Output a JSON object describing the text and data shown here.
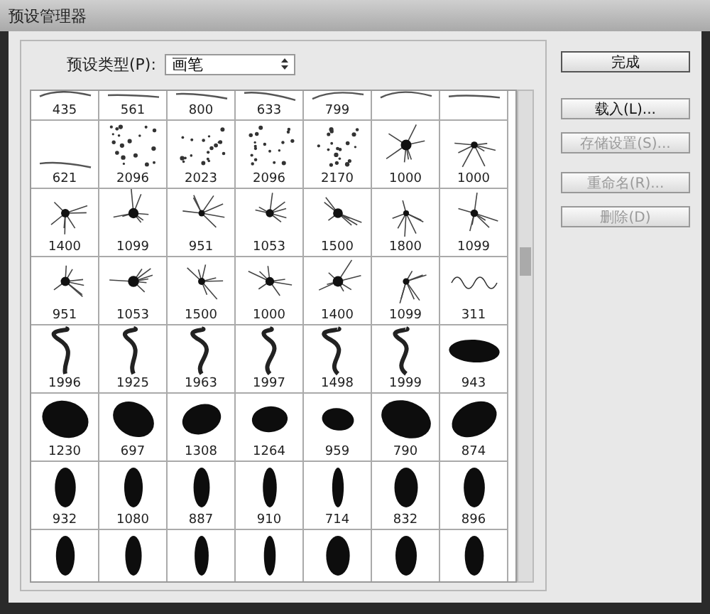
{
  "window": {
    "title": "预设管理器"
  },
  "preset_type": {
    "label": "预设类型(P):",
    "value": "画笔"
  },
  "brush_rows": [
    {
      "cells": [
        {
          "kind": "sparse",
          "label": "435"
        },
        {
          "kind": "sparse",
          "label": "561"
        },
        {
          "kind": "sparse",
          "label": "800"
        },
        {
          "kind": "sparse",
          "label": "633"
        },
        {
          "kind": "sparse",
          "label": "799"
        },
        {
          "kind": "sparse"
        },
        {
          "kind": "sparse"
        }
      ]
    },
    {
      "cells": [
        {
          "kind": "sparse",
          "label": "621"
        },
        {
          "kind": "dots",
          "label": "2096"
        },
        {
          "kind": "dots",
          "label": "2023"
        },
        {
          "kind": "dots",
          "label": "2096"
        },
        {
          "kind": "dots",
          "label": "2170"
        },
        {
          "kind": "splatter",
          "label": "1000"
        },
        {
          "kind": "splatter",
          "label": "1000"
        }
      ]
    },
    {
      "cells": [
        {
          "kind": "splatter",
          "label": "1400"
        },
        {
          "kind": "splatter",
          "label": "1099"
        },
        {
          "kind": "splatter",
          "label": "951"
        },
        {
          "kind": "splatter",
          "label": "1053"
        },
        {
          "kind": "splatter",
          "label": "1500"
        },
        {
          "kind": "splatter",
          "label": "1800"
        },
        {
          "kind": "splatter",
          "label": "1099"
        }
      ]
    },
    {
      "cells": [
        {
          "kind": "splatter",
          "label": "951"
        },
        {
          "kind": "splatter",
          "label": "1053"
        },
        {
          "kind": "splatter",
          "label": "1500"
        },
        {
          "kind": "splatter",
          "label": "1000"
        },
        {
          "kind": "splatter",
          "label": "1400"
        },
        {
          "kind": "splatter",
          "label": "1099"
        },
        {
          "kind": "script",
          "label": "311"
        }
      ]
    },
    {
      "cells": [
        {
          "kind": "smoke",
          "label": "1996"
        },
        {
          "kind": "smoke",
          "label": "1925"
        },
        {
          "kind": "smoke",
          "label": "1963"
        },
        {
          "kind": "smoke",
          "label": "1997"
        },
        {
          "kind": "smoke",
          "label": "1498"
        },
        {
          "kind": "smoke",
          "label": "1999"
        },
        {
          "kind": "blot",
          "label": "943"
        }
      ]
    },
    {
      "cells": [
        {
          "kind": "blot",
          "label": "1230"
        },
        {
          "kind": "blot",
          "label": "697"
        },
        {
          "kind": "blot",
          "label": "1308"
        },
        {
          "kind": "blot",
          "label": "1264"
        },
        {
          "kind": "blot",
          "label": "959"
        },
        {
          "kind": "blot",
          "label": "790"
        },
        {
          "kind": "blot",
          "label": "874"
        }
      ]
    },
    {
      "cells": [
        {
          "kind": "tall",
          "label": "932"
        },
        {
          "kind": "tall",
          "label": "1080"
        },
        {
          "kind": "tall",
          "label": "887"
        },
        {
          "kind": "tall",
          "label": "910"
        },
        {
          "kind": "tall",
          "label": "714"
        },
        {
          "kind": "tall",
          "label": "832"
        },
        {
          "kind": "tall",
          "label": "896"
        }
      ]
    },
    {
      "cells": [
        {
          "kind": "tall"
        },
        {
          "kind": "tall"
        },
        {
          "kind": "tall"
        },
        {
          "kind": "tall"
        },
        {
          "kind": "tall"
        },
        {
          "kind": "tall"
        },
        {
          "kind": "tall"
        }
      ]
    }
  ],
  "buttons": [
    {
      "label": "完成",
      "disabled": false,
      "default": true
    },
    {
      "label": "载入(L)...",
      "disabled": false,
      "default": false
    },
    {
      "label": "存储设置(S)...",
      "disabled": true,
      "default": false
    },
    {
      "label": "重命名(R)...",
      "disabled": true,
      "default": false
    },
    {
      "label": "删除(D)",
      "disabled": true,
      "default": false
    }
  ]
}
